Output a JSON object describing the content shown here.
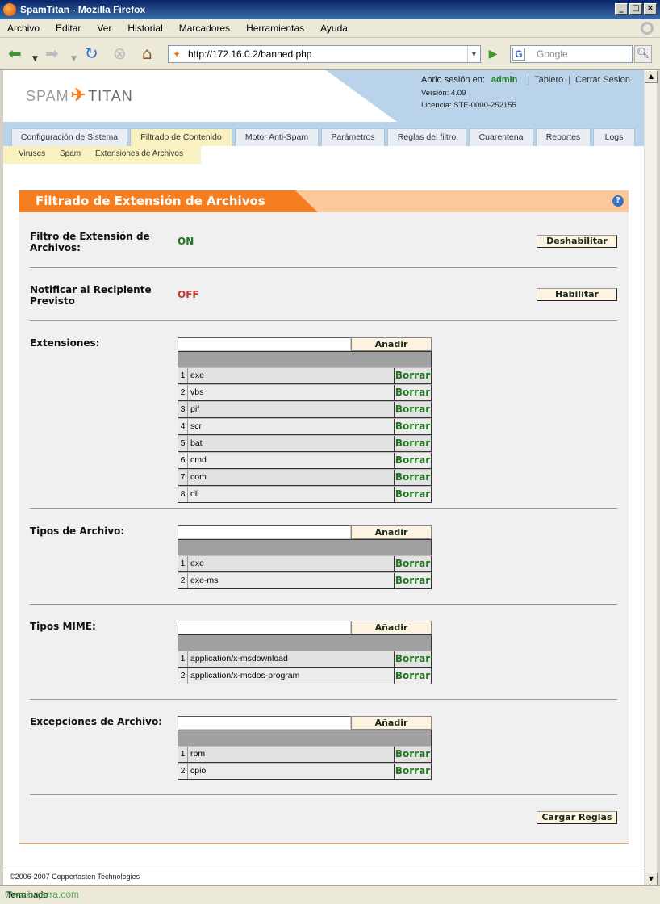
{
  "window": {
    "title": "SpamTitan - Mozilla Firefox"
  },
  "menu": [
    "Archivo",
    "Editar",
    "Ver",
    "Historial",
    "Marcadores",
    "Herramientas",
    "Ayuda"
  ],
  "address": {
    "url": "http://172.16.0.2/banned.php",
    "search_placeholder": "Google"
  },
  "header": {
    "logo_left": "SPAM",
    "logo_right": "TITAN",
    "session_label": "Abrio sesión en:",
    "user": "admin",
    "dashboard": "Tablero",
    "logout": "Cerrar Sesion",
    "version": "Versión: 4.09",
    "license": "Licencia: STE-0000-252155"
  },
  "tabs": [
    "Configuración de Sistema",
    "Filtrado de Contenido",
    "Motor Anti-Spam",
    "Parámetros",
    "Reglas del filtro",
    "Cuarentena",
    "Reportes",
    "Logs"
  ],
  "active_tab": "Filtrado de Contenido",
  "subtabs": [
    "Viruses",
    "Spam",
    "Extensiones de Archivos"
  ],
  "panel": {
    "title": "Filtrado de Extensión de Archivos",
    "filter": {
      "label": "Filtro de Extensión de Archivos:",
      "status": "ON",
      "button": "Deshabilitar"
    },
    "notify": {
      "label": "Notificar al Recipiente Previsto",
      "status": "OFF",
      "button": "Habilitar"
    },
    "add_label": "Añadir",
    "delete_label": "Borrar",
    "extensions": {
      "label": "Extensiones:",
      "items": [
        "exe",
        "vbs",
        "pif",
        "scr",
        "bat",
        "cmd",
        "com",
        "dll"
      ]
    },
    "file_types": {
      "label": "Tipos de Archivo:",
      "items": [
        "exe",
        "exe-ms"
      ]
    },
    "mime_types": {
      "label": "Tipos MIME:",
      "items": [
        "application/x-msdownload",
        "application/x-msdos-program"
      ]
    },
    "exceptions": {
      "label": "Excepciones de Archivo:",
      "items": [
        "rpm",
        "cpio"
      ]
    },
    "load_rules": "Cargar Reglas"
  },
  "footer": {
    "copyright": "©2006-2007 Copperfasten Technologies"
  },
  "statusbar": {
    "text": "Terminado",
    "watermark": "www.bujarra.com"
  }
}
